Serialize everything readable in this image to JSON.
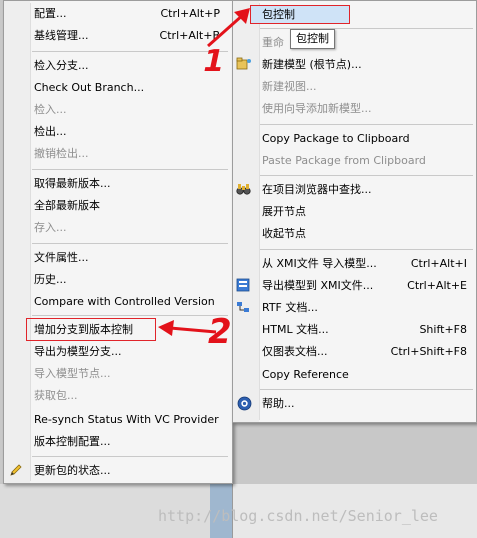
{
  "left_menu": {
    "items": [
      {
        "label": "配置...",
        "shortcut": "Ctrl+Alt+P",
        "disabled": false
      },
      {
        "label": "基线管理...",
        "shortcut": "Ctrl+Alt+B",
        "disabled": false
      },
      {
        "label": "检入分支...",
        "shortcut": "",
        "disabled": false
      },
      {
        "label": "Check Out Branch...",
        "shortcut": "",
        "disabled": false
      },
      {
        "label": "检入...",
        "shortcut": "",
        "disabled": true
      },
      {
        "label": "检出...",
        "shortcut": "",
        "disabled": false
      },
      {
        "label": "撤销检出...",
        "shortcut": "",
        "disabled": true
      },
      {
        "label": "取得最新版本...",
        "shortcut": "",
        "disabled": false
      },
      {
        "label": "全部最新版本",
        "shortcut": "",
        "disabled": false
      },
      {
        "label": "存入...",
        "shortcut": "",
        "disabled": true
      },
      {
        "label": "文件属性...",
        "shortcut": "",
        "disabled": false
      },
      {
        "label": "历史...",
        "shortcut": "",
        "disabled": false
      },
      {
        "label": "Compare with Controlled Version",
        "shortcut": "",
        "disabled": false
      },
      {
        "label": "增加分支到版本控制",
        "shortcut": "",
        "disabled": false
      },
      {
        "label": "导出为模型分支...",
        "shortcut": "",
        "disabled": false
      },
      {
        "label": "导入模型节点...",
        "shortcut": "",
        "disabled": true
      },
      {
        "label": "获取包...",
        "shortcut": "",
        "disabled": true
      },
      {
        "label": "Re-synch Status With VC Provider",
        "shortcut": "",
        "disabled": false
      },
      {
        "label": "版本控制配置...",
        "shortcut": "",
        "disabled": false
      },
      {
        "label": "更新包的状态...",
        "shortcut": "",
        "disabled": false
      }
    ]
  },
  "right_menu": {
    "items": [
      {
        "label": "包控制",
        "shortcut": "",
        "disabled": false
      },
      {
        "label": "重命",
        "shortcut": "",
        "disabled": true
      },
      {
        "label": "新建模型 (根节点)...",
        "shortcut": "",
        "disabled": false
      },
      {
        "label": "新建视图...",
        "shortcut": "",
        "disabled": true
      },
      {
        "label": "使用向导添加新模型...",
        "shortcut": "",
        "disabled": true
      },
      {
        "label": "Copy Package to Clipboard",
        "shortcut": "",
        "disabled": false
      },
      {
        "label": "Paste Package from Clipboard",
        "shortcut": "",
        "disabled": true
      },
      {
        "label": "在项目浏览器中查找...",
        "shortcut": "",
        "disabled": false
      },
      {
        "label": "展开节点",
        "shortcut": "",
        "disabled": false
      },
      {
        "label": "收起节点",
        "shortcut": "",
        "disabled": false
      },
      {
        "label": "从 XMI文件 导入模型...",
        "shortcut": "Ctrl+Alt+I",
        "disabled": false
      },
      {
        "label": "导出模型到 XMI文件...",
        "shortcut": "Ctrl+Alt+E",
        "disabled": false
      },
      {
        "label": "RTF 文档...",
        "shortcut": "",
        "disabled": false
      },
      {
        "label": "HTML 文档...",
        "shortcut": "Shift+F8",
        "disabled": false
      },
      {
        "label": "仅图表文档...",
        "shortcut": "Ctrl+Shift+F8",
        "disabled": false
      },
      {
        "label": "Copy Reference",
        "shortcut": "",
        "disabled": false
      },
      {
        "label": "帮助...",
        "shortcut": "",
        "disabled": false
      }
    ]
  },
  "tooltip": "包控制",
  "annotations": {
    "one": "1",
    "two": "2"
  },
  "watermark": "http://blog.csdn.net/Senior_lee",
  "colors": {
    "annotation_red": "#e3121a",
    "highlight": "#cfe3f7"
  }
}
